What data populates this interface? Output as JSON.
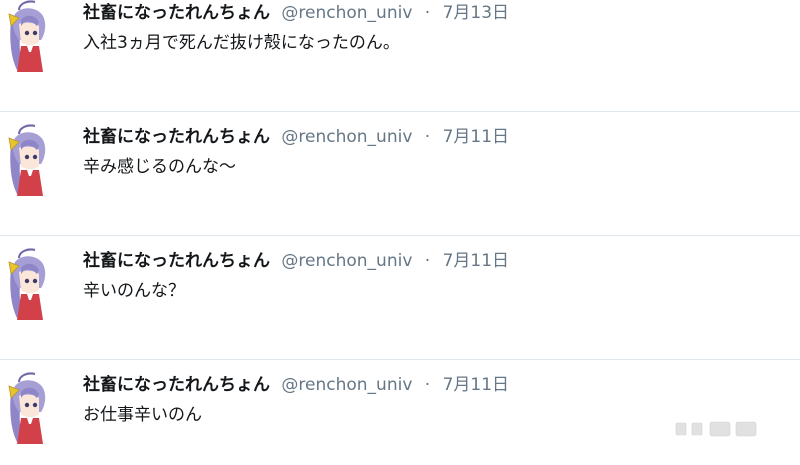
{
  "tweets": [
    {
      "name": "社畜になったれんちょん",
      "handle": "@renchon_univ",
      "separator": "·",
      "date": "7月13日",
      "text": "入社3ヵ月で死んだ抜け殻になったのん。"
    },
    {
      "name": "社畜になったれんちょん",
      "handle": "@renchon_univ",
      "separator": "·",
      "date": "7月11日",
      "text": "辛み感じるのんな〜"
    },
    {
      "name": "社畜になったれんちょん",
      "handle": "@renchon_univ",
      "separator": "·",
      "date": "7月11日",
      "text": "辛いのんな？"
    },
    {
      "name": "社畜になったれんちょん",
      "handle": "@renchon_univ",
      "separator": "·",
      "date": "7月11日",
      "text": "お仕事辛いのん"
    }
  ],
  "avatar_icon": "anime-girl-avatar-icon",
  "watermark_icon": "watermark-logo-icon",
  "colors": {
    "name": "#14171a",
    "meta": "#657786",
    "divider": "#e1e8ed",
    "avatar_hair": "#8e86c8",
    "avatar_ribbon": "#e8c530",
    "avatar_dress": "#d2414a"
  }
}
